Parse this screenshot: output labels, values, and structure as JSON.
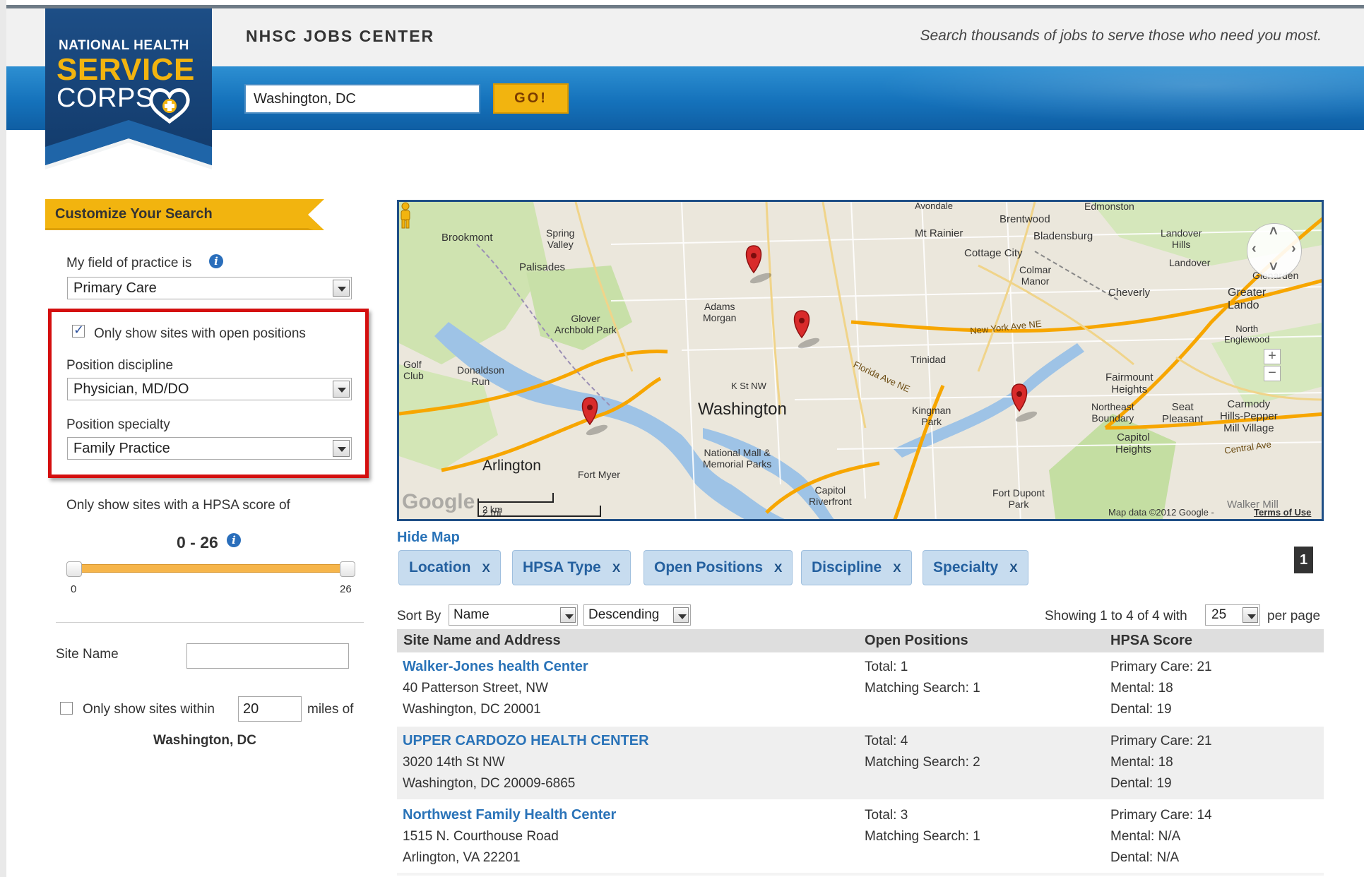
{
  "header": {
    "title": "NHSC JOBS CENTER",
    "tagline": "Search thousands of jobs to serve those who need you most.",
    "search_value": "Washington, DC",
    "go_label": "GO!"
  },
  "logo": {
    "line1": "NATIONAL HEALTH",
    "line2": "SERVICE",
    "line3": "CORPS"
  },
  "sidebar": {
    "banner": "Customize Your Search",
    "field_label": "My field of practice is",
    "field_value": "Primary Care",
    "open_positions_label": "Only show sites with open positions",
    "open_positions_checked": true,
    "discipline_label": "Position discipline",
    "discipline_value": "Physician, MD/DO",
    "specialty_label": "Position specialty",
    "specialty_value": "Family Practice",
    "hpsa_label": "Only show sites with a HPSA score of",
    "hpsa_range": "0 - 26",
    "hpsa_min": "0",
    "hpsa_max": "26",
    "site_name_label": "Site Name",
    "site_name_value": "",
    "within_label": "Only show sites within",
    "within_value": "20",
    "miles_label": "miles of",
    "within_location": "Washington, DC",
    "within_checked": false
  },
  "map": {
    "labels": {
      "avondale": "Avondale",
      "edmonston": "Edmonston",
      "brentwood": "Brentwood",
      "brookmont": "Brookmont",
      "spring_valley": "Spring\nValley",
      "mt_rainier": "Mt Rainier",
      "bladensburg": "Bladensburg",
      "landover_hills": "Landover\nHills",
      "cottage_city": "Cottage City",
      "palisades": "Palisades",
      "colmar_manor": "Colmar\nManor",
      "landover": "Landover",
      "glenarden": "Glenarden",
      "cheverly": "Cheverly",
      "greater_landover": "Greater\nLando",
      "adams_morgan": "Adams\nMorgan",
      "glover_archbold": "Glover\nArchbold Park",
      "north_englewood": "North\nEnglewood",
      "golf_club": "Golf\nClub",
      "donaldson_run": "Donaldson\nRun",
      "trinidad": "Trinidad",
      "fairmount_heights": "Fairmount\nHeights",
      "washington": "Washington",
      "k_st": "K St NW",
      "kingman_park": "Kingman\nPark",
      "ne_boundary": "Northeast\nBoundary",
      "seat_pleasant": "Seat\nPleasant",
      "carmody": "Carmody\nHills-Pepper\nMill Village",
      "arlington": "Arlington",
      "national_mall": "National Mall &\nMemorial Parks",
      "capitol_heights": "Capitol\nHeights",
      "fort_myer": "Fort Myer",
      "capitol_riverfront": "Capitol\nRiverfront",
      "fort_dupont": "Fort Dupont\nPark",
      "new_york_ave": "New York Ave NE",
      "central_ave": "Central Ave",
      "florida_ave": "Florida Ave NE",
      "scale": "2 mi",
      "scale2": "2 km",
      "attribution": "Map data ©2012 Google -",
      "terms": "Terms of Use",
      "google": "Google",
      "walker_mill": "Walker Mill"
    },
    "hide_map_label": "Hide Map"
  },
  "filters": {
    "chips": [
      "Location",
      "HPSA Type",
      "Open Positions",
      "Discipline",
      "Specialty"
    ],
    "remove_glyph": "X",
    "page_number": "1"
  },
  "sort": {
    "sort_by_label": "Sort By",
    "sort_field": "Name",
    "sort_order": "Descending",
    "showing_text": "Showing 1 to 4 of 4 with",
    "per_page_value": "25",
    "per_page_label": "per page"
  },
  "table": {
    "headers": [
      "Site Name and Address",
      "Open Positions",
      "HPSA Score"
    ],
    "rows": [
      {
        "name": "Walker-Jones health Center",
        "address1": "40 Patterson Street, NW",
        "address2": "Washington, DC 20001",
        "total": "Total: 1",
        "matching": "Matching Search: 1",
        "primary": "Primary Care: 21",
        "mental": "Mental: 18",
        "dental": "Dental: 19"
      },
      {
        "name": "UPPER CARDOZO HEALTH CENTER",
        "address1": "3020 14th St NW",
        "address2": "Washington, DC 20009-6865",
        "total": "Total: 4",
        "matching": "Matching Search: 2",
        "primary": "Primary Care: 21",
        "mental": "Mental: 18",
        "dental": "Dental: 19"
      },
      {
        "name": "Northwest Family Health Center",
        "address1": "1515 N. Courthouse Road",
        "address2": "Arlington, VA 22201",
        "total": "Total: 3",
        "matching": "Matching Search: 1",
        "primary": "Primary Care: 14",
        "mental": "Mental: N/A",
        "dental": "Dental: N/A"
      }
    ]
  },
  "colors": {
    "header_blue": "#1572bb",
    "go_yellow": "#f2b40f",
    "link_blue": "#2a73b8",
    "highlight_red": "#d40f0f",
    "chip_bg": "#c7dcef"
  }
}
